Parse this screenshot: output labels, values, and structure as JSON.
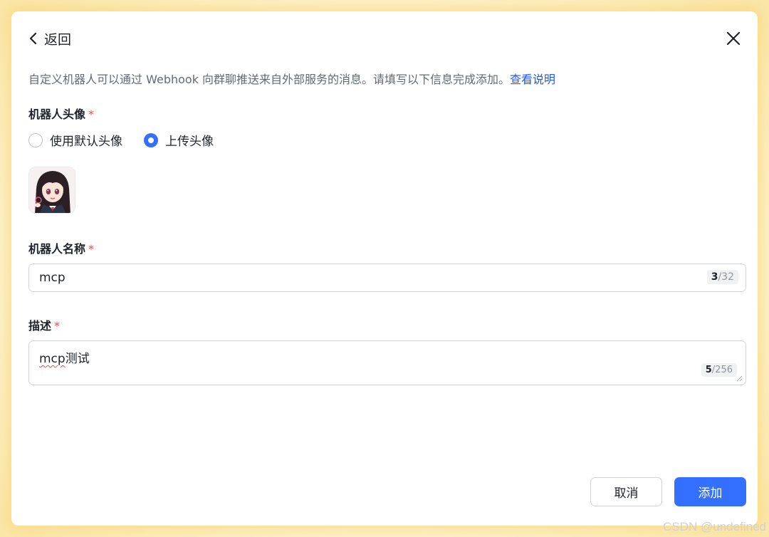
{
  "header": {
    "back_label": "返回"
  },
  "description": {
    "text": "自定义机器人可以通过 Webhook 向群聊推送来自外部服务的消息。请填写以下信息完成添加。",
    "link_text": "查看说明"
  },
  "avatar_section": {
    "label": "机器人头像",
    "required_mark": "*",
    "options": [
      {
        "label": "使用默认头像",
        "selected": false
      },
      {
        "label": "上传头像",
        "selected": true
      }
    ]
  },
  "name_section": {
    "label": "机器人名称",
    "required_mark": "*",
    "value": "mcp",
    "count_current": "3",
    "count_max": "/32"
  },
  "desc_section": {
    "label": "描述",
    "required_mark": "*",
    "value_misspelled": "mcp",
    "value_rest": "测试",
    "count_current": "5",
    "count_max": "/256"
  },
  "buttons": {
    "cancel": "取消",
    "add": "添加"
  },
  "watermark": "CSDN @undefined",
  "colors": {
    "primary": "#3370ff",
    "required": "#f54a45",
    "link": "#245bdb"
  },
  "icons": {
    "back": "chevron-left-icon",
    "close": "close-icon",
    "resize": "resize-handle-icon"
  }
}
